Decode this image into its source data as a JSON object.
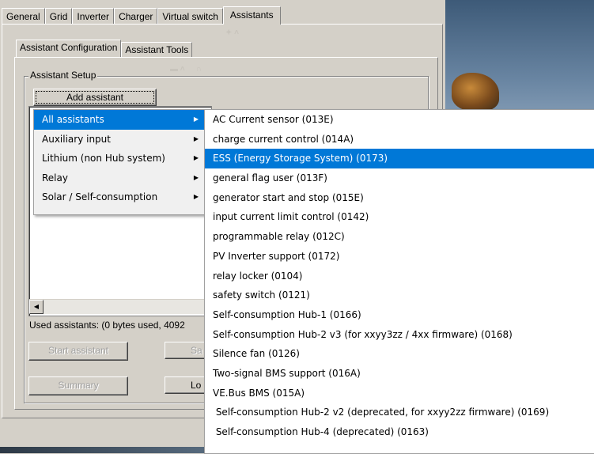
{
  "main_tabs": [
    "General",
    "Grid",
    "Inverter",
    "Charger",
    "Virtual switch",
    "Assistants"
  ],
  "active_main_tab": "Assistants",
  "sub_tabs": [
    "Assistant Configuration",
    "Assistant Tools"
  ],
  "group": {
    "label": "Assistant Setup",
    "add_button": "Add assistant",
    "used_text": "Used assistants: (0 bytes used, 4092",
    "start_button": "Start assistant",
    "save_button_partial": "Sa",
    "summary_button": "Summary",
    "load_button_partial": "Lo"
  },
  "menu_level1": [
    {
      "label": "All assistants",
      "highlighted": true
    },
    {
      "label": "Auxiliary input",
      "highlighted": false
    },
    {
      "label": "Lithium (non Hub system)",
      "highlighted": false
    },
    {
      "label": "Relay",
      "highlighted": false
    },
    {
      "label": "Solar / Self-consumption",
      "highlighted": false
    }
  ],
  "menu_level2": [
    {
      "label": "AC Current sensor (013E)",
      "highlighted": false
    },
    {
      "label": "charge current control (014A)",
      "highlighted": false
    },
    {
      "label": "ESS (Energy Storage System) (0173)",
      "highlighted": true
    },
    {
      "label": "general flag user (013F)",
      "highlighted": false
    },
    {
      "label": "generator start and stop (015E)",
      "highlighted": false
    },
    {
      "label": "input current limit control (0142)",
      "highlighted": false
    },
    {
      "label": "programmable relay (012C)",
      "highlighted": false
    },
    {
      "label": "PV Inverter support (0172)",
      "highlighted": false
    },
    {
      "label": "relay locker (0104)",
      "highlighted": false
    },
    {
      "label": "safety switch (0121)",
      "highlighted": false
    },
    {
      "label": "Self-consumption Hub-1 (0166)",
      "highlighted": false
    },
    {
      "label": "Self-consumption Hub-2 v3 (for xxyy3zz / 4xx firmware) (0168)",
      "highlighted": false
    },
    {
      "label": "Silence fan (0126)",
      "highlighted": false
    },
    {
      "label": "Two-signal BMS support (016A)",
      "highlighted": false
    },
    {
      "label": "VE.Bus BMS (015A)",
      "highlighted": false
    },
    {
      "label": " Self-consumption Hub-2 v2 (deprecated, for xxyy2zz firmware) (0169)",
      "highlighted": false
    },
    {
      "label": " Self-consumption Hub-4 (deprecated) (0163)",
      "highlighted": false
    }
  ],
  "colors": {
    "highlight": "#0078d7",
    "window_bg": "#d4d0c8"
  }
}
